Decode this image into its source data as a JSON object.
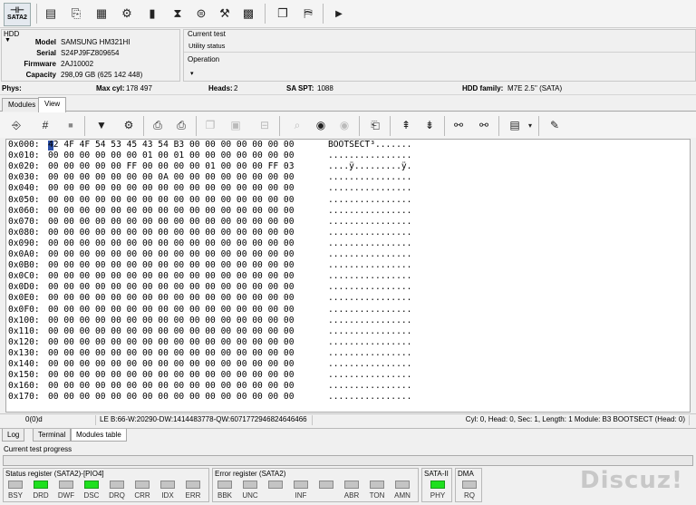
{
  "toolbar1": {
    "sata_label": "SATA2",
    "icons": [
      "disk-drive-icon",
      "scroll-icon",
      "database-icon",
      "sector-icon",
      "gear-icon",
      "chip-icon",
      "hourglass-icon",
      "open-folder-icon",
      "tools-icon",
      "grid-icon",
      "copy-icon",
      "run-icon",
      "play-icon"
    ]
  },
  "hdd": {
    "title": "HDD",
    "model_label": "Model",
    "model": "SAMSUNG HM321HI",
    "serial_label": "Serial",
    "serial": "S24PJ9FZ809654",
    "firmware_label": "Firmware",
    "firmware": "2AJ10002",
    "capacity_label": "Capacity",
    "capacity": "298,09 GB (625 142 448)"
  },
  "test": {
    "title": "Current test",
    "value": "Utility status",
    "operation_label": "Operation"
  },
  "phys": {
    "phys_label": "Phys:",
    "maxcyl_label": "Max cyl:",
    "maxcyl": "178 497",
    "heads_label": "Heads:",
    "heads": "2",
    "saspt_label": "SA SPT:",
    "saspt": "1088",
    "family_label": "HDD family:",
    "family": "M7E 2.5'' (SATA)"
  },
  "tabs": [
    "Modules",
    "View"
  ],
  "hex_rows": [
    {
      "addr": "0x000:",
      "bytes": "42 4F 4F 54 53 45 43 54 B3 00 00 00 00 00 00 00",
      "ascii": "BOOTSECT³......."
    },
    {
      "addr": "0x010:",
      "bytes": "00 00 00 00 00 00 01 00 01 00 00 00 00 00 00 00",
      "ascii": "................"
    },
    {
      "addr": "0x020:",
      "bytes": "00 00 00 00 00 FF 00 00 00 00 01 00 00 00 FF 03",
      "ascii": "....ÿ.........ÿ."
    },
    {
      "addr": "0x030:",
      "bytes": "00 00 00 00 00 00 00 0A 00 00 00 00 00 00 00 00",
      "ascii": "................"
    },
    {
      "addr": "0x040:",
      "bytes": "00 00 00 00 00 00 00 00 00 00 00 00 00 00 00 00",
      "ascii": "................"
    },
    {
      "addr": "0x050:",
      "bytes": "00 00 00 00 00 00 00 00 00 00 00 00 00 00 00 00",
      "ascii": "................"
    },
    {
      "addr": "0x060:",
      "bytes": "00 00 00 00 00 00 00 00 00 00 00 00 00 00 00 00",
      "ascii": "................"
    },
    {
      "addr": "0x070:",
      "bytes": "00 00 00 00 00 00 00 00 00 00 00 00 00 00 00 00",
      "ascii": "................"
    },
    {
      "addr": "0x080:",
      "bytes": "00 00 00 00 00 00 00 00 00 00 00 00 00 00 00 00",
      "ascii": "................"
    },
    {
      "addr": "0x090:",
      "bytes": "00 00 00 00 00 00 00 00 00 00 00 00 00 00 00 00",
      "ascii": "................"
    },
    {
      "addr": "0x0A0:",
      "bytes": "00 00 00 00 00 00 00 00 00 00 00 00 00 00 00 00",
      "ascii": "................"
    },
    {
      "addr": "0x0B0:",
      "bytes": "00 00 00 00 00 00 00 00 00 00 00 00 00 00 00 00",
      "ascii": "................"
    },
    {
      "addr": "0x0C0:",
      "bytes": "00 00 00 00 00 00 00 00 00 00 00 00 00 00 00 00",
      "ascii": "................"
    },
    {
      "addr": "0x0D0:",
      "bytes": "00 00 00 00 00 00 00 00 00 00 00 00 00 00 00 00",
      "ascii": "................"
    },
    {
      "addr": "0x0E0:",
      "bytes": "00 00 00 00 00 00 00 00 00 00 00 00 00 00 00 00",
      "ascii": "................"
    },
    {
      "addr": "0x0F0:",
      "bytes": "00 00 00 00 00 00 00 00 00 00 00 00 00 00 00 00",
      "ascii": "................"
    },
    {
      "addr": "0x100:",
      "bytes": "00 00 00 00 00 00 00 00 00 00 00 00 00 00 00 00",
      "ascii": "................"
    },
    {
      "addr": "0x110:",
      "bytes": "00 00 00 00 00 00 00 00 00 00 00 00 00 00 00 00",
      "ascii": "................"
    },
    {
      "addr": "0x120:",
      "bytes": "00 00 00 00 00 00 00 00 00 00 00 00 00 00 00 00",
      "ascii": "................"
    },
    {
      "addr": "0x130:",
      "bytes": "00 00 00 00 00 00 00 00 00 00 00 00 00 00 00 00",
      "ascii": "................"
    },
    {
      "addr": "0x140:",
      "bytes": "00 00 00 00 00 00 00 00 00 00 00 00 00 00 00 00",
      "ascii": "................"
    },
    {
      "addr": "0x150:",
      "bytes": "00 00 00 00 00 00 00 00 00 00 00 00 00 00 00 00",
      "ascii": "................"
    },
    {
      "addr": "0x160:",
      "bytes": "00 00 00 00 00 00 00 00 00 00 00 00 00 00 00 00",
      "ascii": "................"
    },
    {
      "addr": "0x170:",
      "bytes": "00 00 00 00 00 00 00 00 00 00 00 00 00 00 00 00",
      "ascii": "................"
    }
  ],
  "status": {
    "offset": "0(0)d",
    "values": "LE B:66-W:20290-DW:1414483778-QW:6071772946824646466",
    "position": "Cyl: 0, Head: 0, Sec: 1, Length: 1 Module: B3 BOOTSECT (Head: 0)"
  },
  "bottom_tabs": [
    "Log",
    "Terminal",
    "Modules table"
  ],
  "progress_label": "Current test progress",
  "registers": {
    "status_title": "Status register (SATA2)-[PIO4]",
    "status_leds": [
      {
        "label": "BSY",
        "on": false
      },
      {
        "label": "DRD",
        "on": true
      },
      {
        "label": "DWF",
        "on": false
      },
      {
        "label": "DSC",
        "on": true
      },
      {
        "label": "DRQ",
        "on": false
      },
      {
        "label": "CRR",
        "on": false
      },
      {
        "label": "IDX",
        "on": false
      },
      {
        "label": "ERR",
        "on": false
      }
    ],
    "error_title": "Error register (SATA2)",
    "error_leds": [
      {
        "label": "BBK",
        "on": false
      },
      {
        "label": "UNC",
        "on": false
      },
      {
        "label": "",
        "on": false
      },
      {
        "label": "INF",
        "on": false
      },
      {
        "label": "",
        "on": false
      },
      {
        "label": "ABR",
        "on": false
      },
      {
        "label": "TON",
        "on": false
      },
      {
        "label": "AMN",
        "on": false
      }
    ],
    "sata_title": "SATA-II",
    "sata_leds": [
      {
        "label": "PHY",
        "on": true
      }
    ],
    "dma_title": "DMA",
    "dma_leds": [
      {
        "label": "RQ",
        "on": false
      }
    ]
  },
  "watermark": "Discuz!"
}
